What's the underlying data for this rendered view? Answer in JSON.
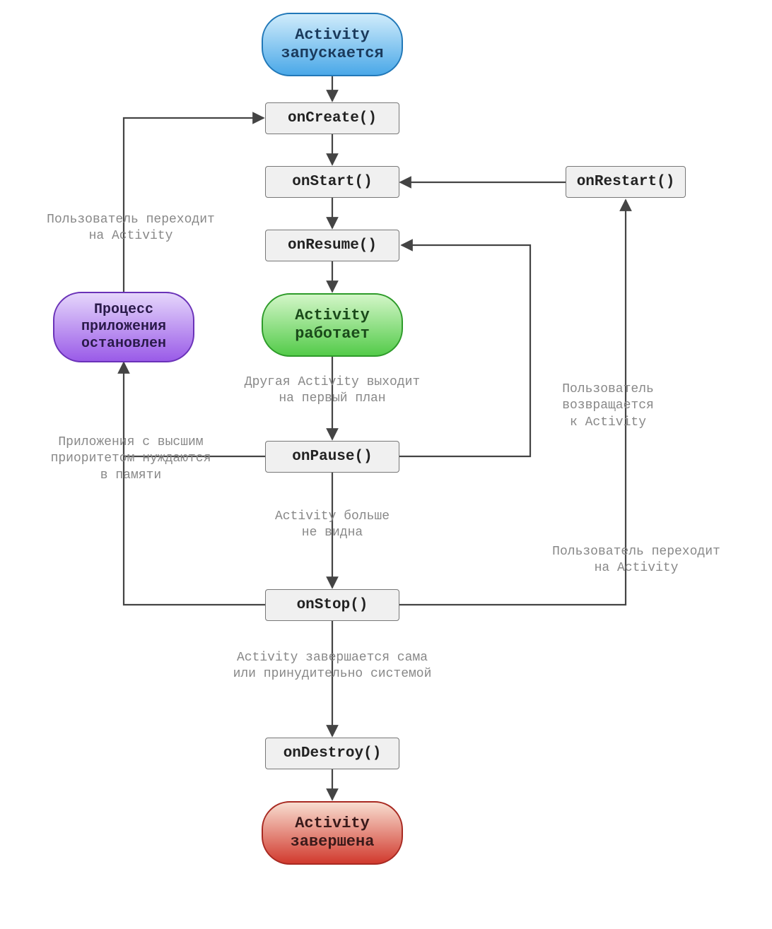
{
  "nodes": {
    "start": {
      "line1": "Activity",
      "line2": "запускается"
    },
    "onCreate": "onCreate()",
    "onStart": "onStart()",
    "onResume": "onResume()",
    "running": {
      "line1": "Activity",
      "line2": "работает"
    },
    "onPause": "onPause()",
    "onStop": "onStop()",
    "onDestroy": "onDestroy()",
    "finished": {
      "line1": "Activity",
      "line2": "завершена"
    },
    "onRestart": "onRestart()",
    "killed": {
      "line1": "Процесс",
      "line2": "приложения",
      "line3": "остановлен"
    }
  },
  "labels": {
    "foreground": {
      "line1": "Другая Activity выходит",
      "line2": "на первый план"
    },
    "notVisible": {
      "line1": "Activity больше",
      "line2": "не видна"
    },
    "finishing": {
      "line1": "Activity завершается сама",
      "line2": "или принудительно системой"
    },
    "userReturns": {
      "line1": "Пользователь",
      "line2": "возвращается",
      "line3": "к Activity"
    },
    "userNavRight": {
      "line1": "Пользователь переходит",
      "line2": "на Activity"
    },
    "highPriority": {
      "line1": "Приложения с высшим",
      "line2": "приоритетом нуждаются",
      "line3": "в памяти"
    },
    "userNavLeft": {
      "line1": "Пользователь переходит",
      "line2": "на Activity"
    }
  }
}
